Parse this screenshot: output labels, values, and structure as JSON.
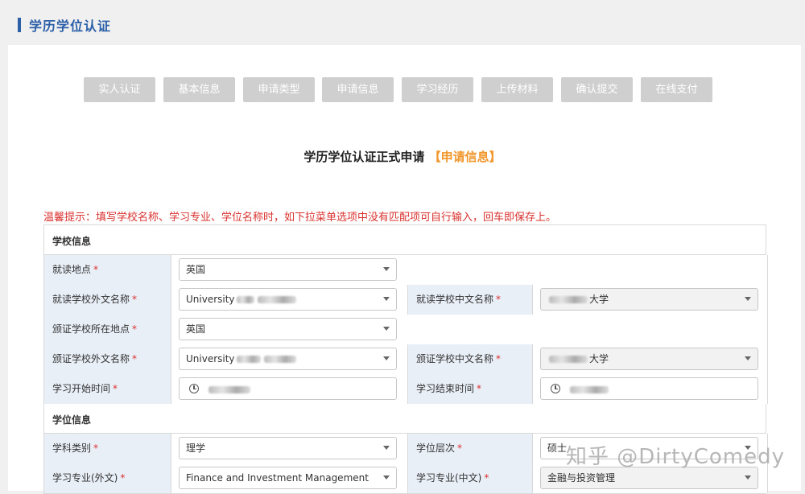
{
  "page": {
    "title": "学历学位认证"
  },
  "steps": [
    "实人认证",
    "基本信息",
    "申请类型",
    "申请信息",
    "学习经历",
    "上传材料",
    "确认提交",
    "在线支付"
  ],
  "heading": {
    "main": "学历学位认证正式申请",
    "sub": "【申请信息】"
  },
  "tip": "温馨提示：填写学校名称、学习专业、学位名称时，如下拉菜单选项中没有匹配项可自行输入，回车即保存上。",
  "sections": {
    "school": "学校信息",
    "degree": "学位信息"
  },
  "fields": {
    "study_location": {
      "label": "就读地点",
      "value": "英国"
    },
    "school_foreign": {
      "label": "就读学校外文名称",
      "value": "University"
    },
    "school_chinese": {
      "label": "就读学校中文名称",
      "value": "大学"
    },
    "cert_location": {
      "label": "颁证学校所在地点",
      "value": "英国"
    },
    "cert_foreign": {
      "label": "颁证学校外文名称",
      "value": "University"
    },
    "cert_chinese": {
      "label": "颁证学校中文名称",
      "value": "大学"
    },
    "start_time": {
      "label": "学习开始时间"
    },
    "end_time": {
      "label": "学习结束时间"
    },
    "subject": {
      "label": "学科类别",
      "value": "理学"
    },
    "degree_level": {
      "label": "学位层次",
      "value": "硕士"
    },
    "major_foreign": {
      "label": "学习专业(外文)",
      "value": "Finance and Investment Management"
    },
    "major_chinese": {
      "label": "学习专业(中文)",
      "value": "金融与投资管理"
    }
  },
  "required_mark": "*",
  "watermark": "知乎 @DirtyComedy"
}
